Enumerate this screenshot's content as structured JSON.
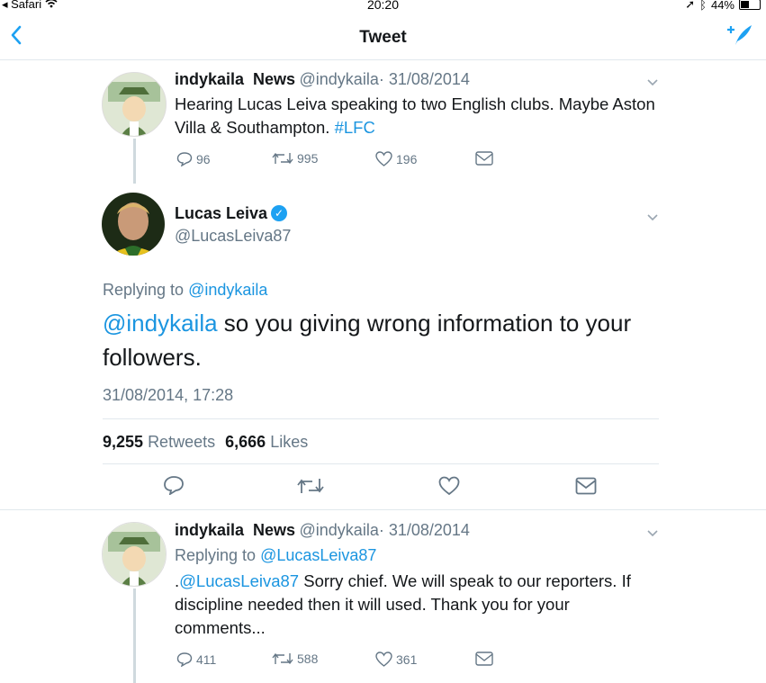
{
  "status_bar": {
    "app": "Safari",
    "time": "20:20",
    "battery": "44%"
  },
  "nav": {
    "title": "Tweet"
  },
  "tweet1": {
    "name": "indykaila  News",
    "handle": "@indykaila",
    "date": "· 31/08/2014",
    "text": "Hearing Lucas Leiva speaking to two English clubs. Maybe Aston Villa & Southampton.",
    "hashtag": "#LFC",
    "replies": "96",
    "retweets": "995",
    "likes": "196"
  },
  "main_tweet": {
    "name": "Lucas Leiva",
    "handle": "@LucasLeiva87",
    "replying_prefix": "Replying to",
    "replying_to": "@indykaila",
    "mention": "@indykaila",
    "text": " so you giving wrong information to your followers.",
    "timestamp": "31/08/2014, 17:28",
    "retweet_count": "9,255",
    "retweet_label": "Retweets",
    "like_count": "6,666",
    "like_label": "Likes"
  },
  "tweet3": {
    "name": "indykaila  News",
    "handle": "@indykaila",
    "date": "· 31/08/2014",
    "replying_prefix": "Replying to",
    "replying_to": "@LucasLeiva87",
    "mention_prefix": ".",
    "mention": "@LucasLeiva87",
    "text": " Sorry chief. We will speak to our reporters. If discipline needed then it will used. Thank you for your comments...",
    "replies": "411",
    "retweets": "588",
    "likes": "361"
  },
  "colors": {
    "accent": "#1da1f2",
    "link": "#1b95e0",
    "muted": "#657786"
  },
  "icons": [
    "chevron-left-icon",
    "compose-icon",
    "reply-icon",
    "retweet-icon",
    "like-icon",
    "dm-icon",
    "verified-icon",
    "wifi-icon",
    "bluetooth-icon",
    "location-icon"
  ]
}
